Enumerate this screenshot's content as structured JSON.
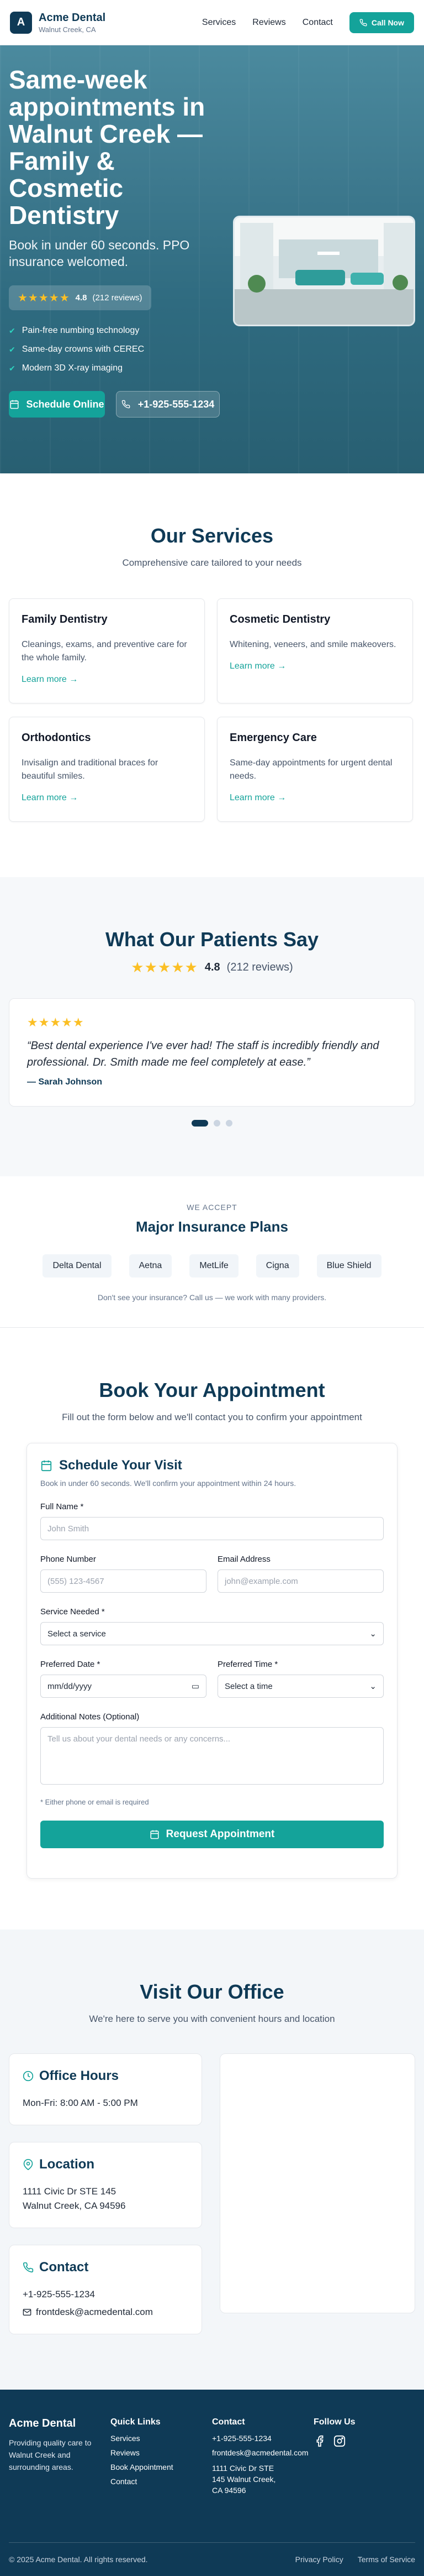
{
  "colors": {
    "brand": "#0f3a56",
    "accent": "#14a39a",
    "star": "#fbbf24"
  },
  "nav": {
    "logo_letter": "A",
    "brand": "Acme Dental",
    "location": "Walnut Creek, CA",
    "links": [
      "Services",
      "Reviews",
      "Contact"
    ],
    "call_label": "Call Now"
  },
  "hero": {
    "title": "Same-week appointments in Walnut Creek — Family & Cosmetic Dentistry",
    "subtitle": "Book in under 60 seconds. PPO insurance welcomed.",
    "rating_value": "4.8",
    "rating_count": "(212 reviews)",
    "features": [
      "Pain-free numbing technology",
      "Same-day crowns with CEREC",
      "Modern 3D X-ray imaging"
    ],
    "schedule_label": "Schedule Online",
    "phone_label": "+1-925-555-1234"
  },
  "services": {
    "title": "Our Services",
    "subtitle": "Comprehensive care tailored to your needs",
    "link_label": "Learn more →",
    "items": [
      {
        "title": "Family Dentistry",
        "desc": "Cleanings, exams, and preventive care for the whole family."
      },
      {
        "title": "Cosmetic Dentistry",
        "desc": "Whitening, veneers, and smile makeovers."
      },
      {
        "title": "Orthodontics",
        "desc": "Invisalign and traditional braces for beautiful smiles."
      },
      {
        "title": "Emergency Care",
        "desc": "Same-day appointments for urgent dental needs."
      }
    ]
  },
  "testimonials": {
    "title": "What Our Patients Say",
    "rating_value": "4.8",
    "rating_count": "(212 reviews)",
    "quote": "“Best dental experience I've ever had! The staff is incredibly friendly and professional. Dr. Smith made me feel completely at ease.”",
    "author": "— Sarah Johnson"
  },
  "insurance": {
    "kicker": "WE ACCEPT",
    "title": "Major Insurance Plans",
    "plans": [
      "Delta Dental",
      "Aetna",
      "MetLife",
      "Cigna",
      "Blue Shield"
    ],
    "note": "Don't see your insurance? Call us — we work with many providers."
  },
  "booking": {
    "title": "Book Your Appointment",
    "subtitle": "Fill out the form below and we'll contact you to confirm your appointment",
    "form_title": "Schedule Your Visit",
    "form_sub": "Book in under 60 seconds. We'll confirm your appointment within 24 hours.",
    "full_name_label": "Full Name *",
    "full_name_placeholder": "John Smith",
    "phone_label": "Phone Number",
    "phone_placeholder": "(555) 123-4567",
    "email_label": "Email Address",
    "email_placeholder": "john@example.com",
    "service_label": "Service Needed *",
    "service_value": "Select a service",
    "date_label": "Preferred Date *",
    "date_value": "mm/dd/yyyy",
    "time_label": "Preferred Time *",
    "time_value": "Select a time",
    "notes_label": "Additional Notes (Optional)",
    "notes_placeholder": "Tell us about your dental needs or any concerns...",
    "req_note": "* Either phone or email is required",
    "submit_label": "Request Appointment"
  },
  "office": {
    "title": "Visit Our Office",
    "subtitle": "We're here to serve you with convenient hours and location",
    "hours_title": "Office Hours",
    "hours_text": "Mon-Fri: 8:00 AM - 5:00 PM",
    "location_title": "Location",
    "address_line1": "1111 Civic Dr STE 145",
    "address_line2": "Walnut Creek, CA 94596",
    "contact_title": "Contact",
    "phone": "+1-925-555-1234",
    "email": "frontdesk@acmedental.com"
  },
  "footer": {
    "brand": "Acme Dental",
    "tagline": "Providing quality care to Walnut Creek and surrounding areas.",
    "quick_links_title": "Quick Links",
    "quick_links": [
      "Services",
      "Reviews",
      "Book Appointment",
      "Contact"
    ],
    "contact_title": "Contact",
    "phone": "+1-925-555-1234",
    "email": "frontdesk@acmedental.com",
    "address": "1111 Civic Dr STE 145 Walnut Creek, CA 94596",
    "follow_title": "Follow Us",
    "copyright": "© 2025 Acme Dental. All rights reserved.",
    "privacy": "Privacy Policy",
    "terms": "Terms of Service"
  }
}
